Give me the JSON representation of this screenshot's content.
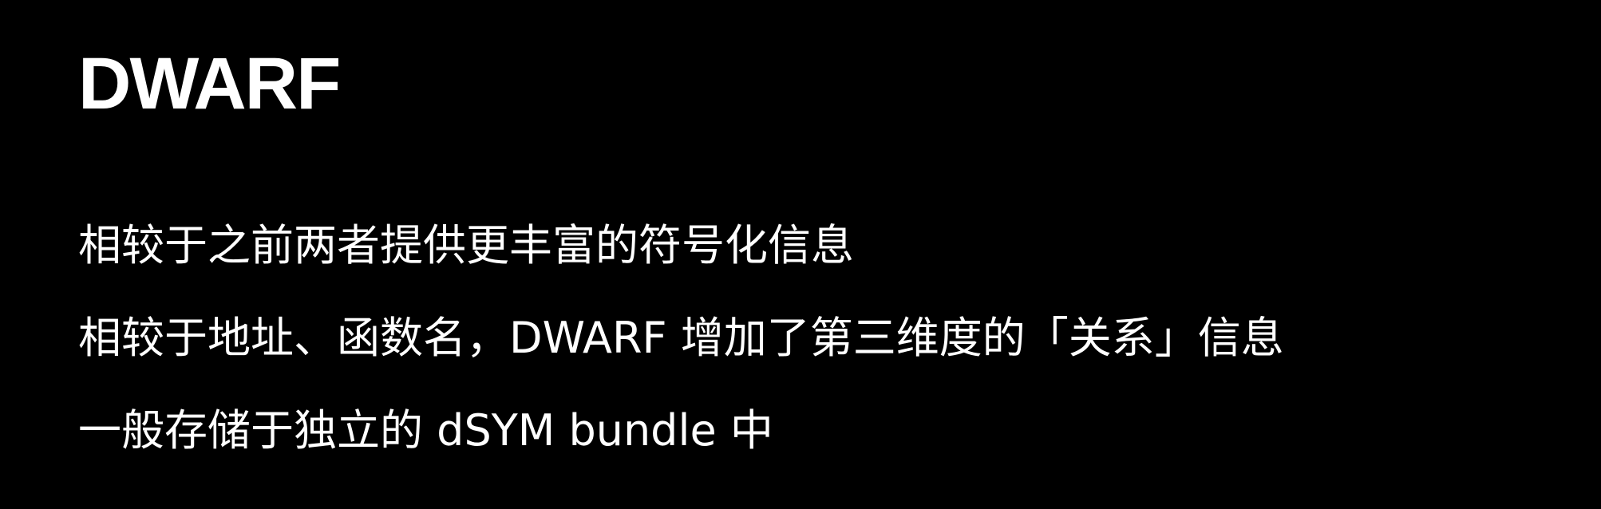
{
  "slide": {
    "title": "DWARF",
    "bullets": [
      "相较于之前两者提供更丰富的符号化信息",
      "相较于地址、函数名，DWARF 增加了第三维度的「关系」信息",
      "一般存储于独立的 dSYM bundle 中"
    ]
  },
  "colors": {
    "background": "#000000",
    "text": "#ffffff"
  }
}
